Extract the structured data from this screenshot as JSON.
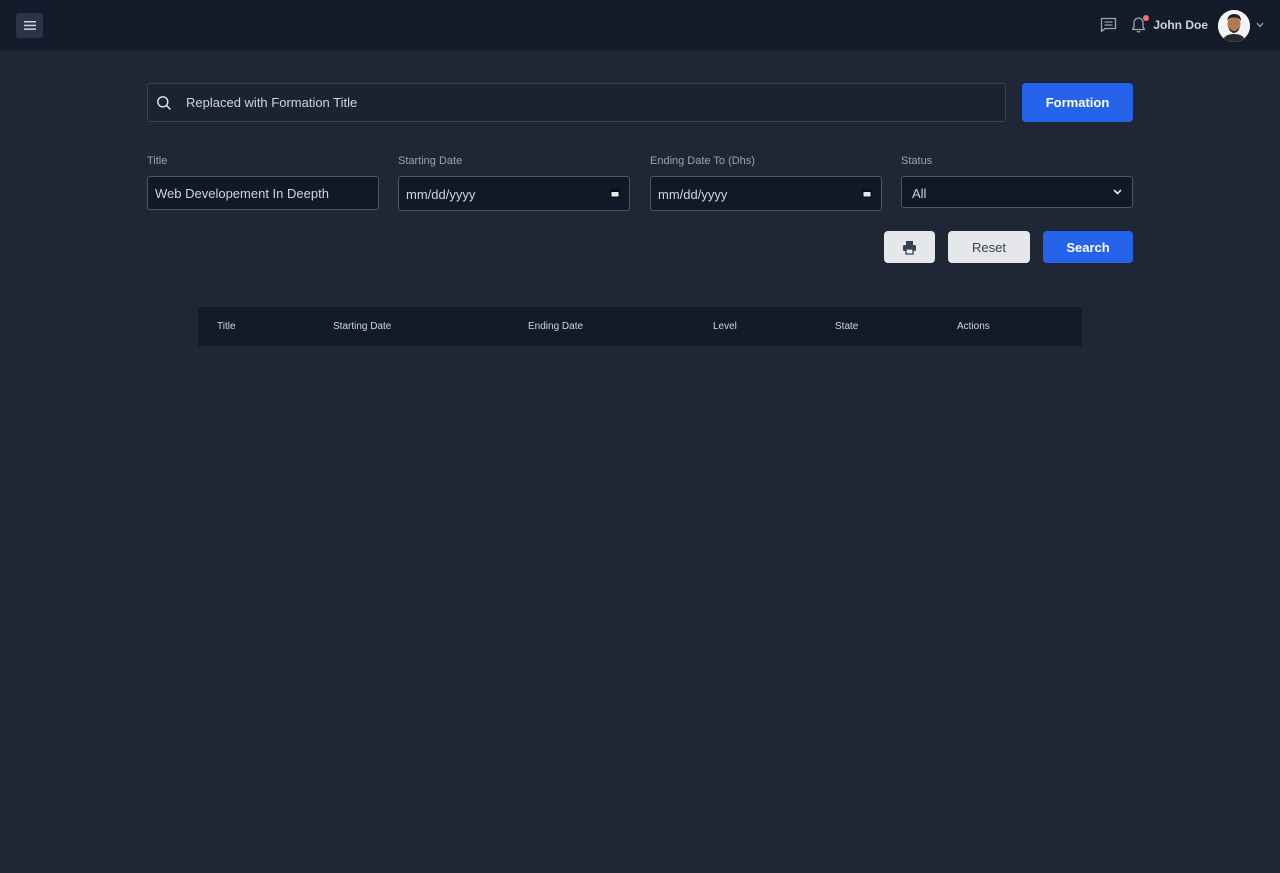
{
  "topbar": {
    "menu_icon": "hamburger-icon",
    "chat_icon": "chat-icon",
    "bell_icon": "bell-icon",
    "user_name": "John Doe",
    "avatar_icon": "user-avatar"
  },
  "search": {
    "placeholder": "Replaced with Formation Title",
    "value": "",
    "button_label": "Formation"
  },
  "filters": {
    "title_label": "Title",
    "title_value": "Web Developement In Deepth",
    "start_label": "Starting Date",
    "start_value": "mm/dd/yyyy",
    "end_label": "Ending Date To (Dhs)",
    "end_value": "mm/dd/yyyy",
    "status_label": "Status",
    "status_value": "All"
  },
  "actions": {
    "print_icon": "printer-icon",
    "reset_label": "Reset",
    "search_label": "Search"
  },
  "table": {
    "columns": [
      "Title",
      "Starting Date",
      "Ending Date",
      "Level",
      "State",
      "Actions"
    ]
  },
  "colors": {
    "accent": "#2563eb",
    "background": "#1f2737",
    "topbar": "#141b2a",
    "notification_dot": "#f87171"
  }
}
